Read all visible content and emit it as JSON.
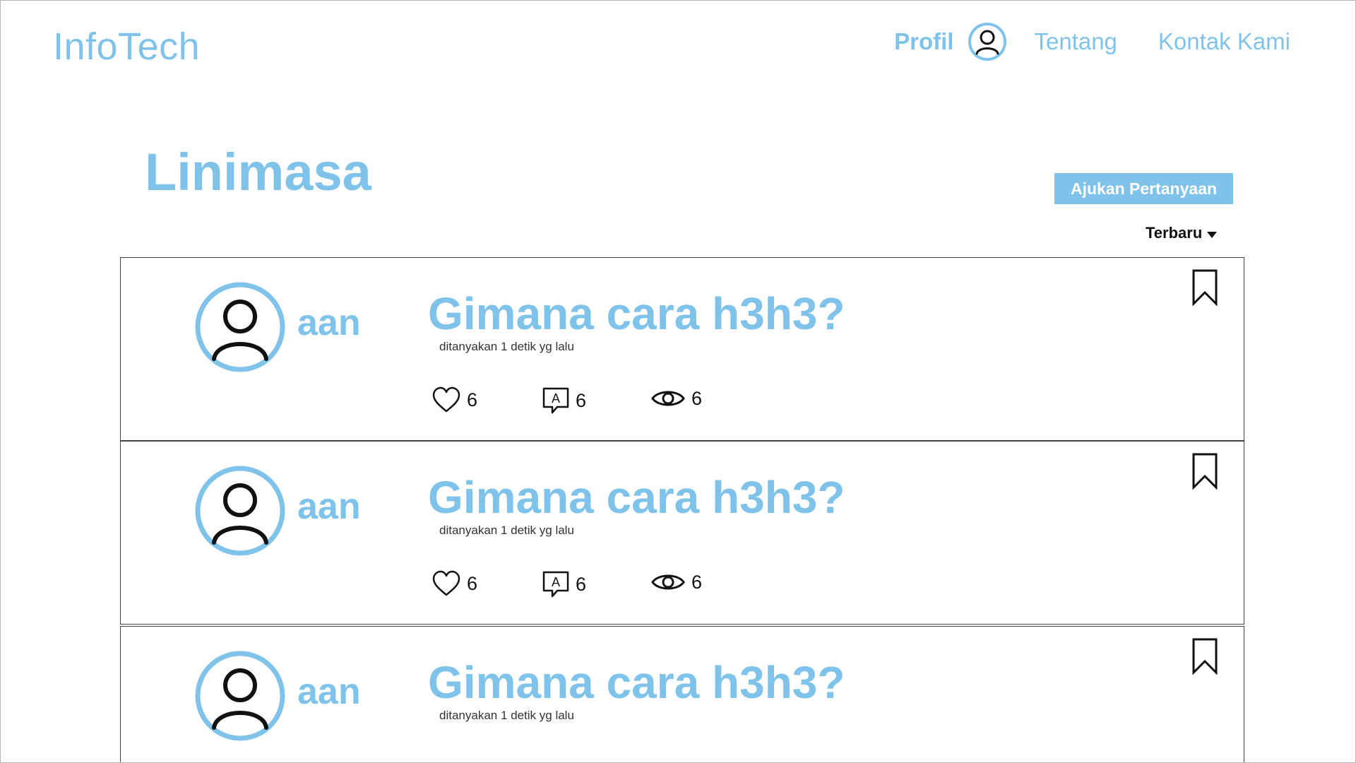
{
  "header": {
    "brand": "InfoTech",
    "nav": {
      "profile": "Profil",
      "about": "Tentang",
      "contact": "Kontak Kami"
    }
  },
  "main": {
    "title": "Linimasa",
    "ask_button": "Ajukan Pertanyaan",
    "sort_label": "Terbaru"
  },
  "posts": [
    {
      "author": "aan",
      "title": "Gimana cara h3h3?",
      "time": "ditanyakan 1 detik yg lalu",
      "likes": "6",
      "answers": "6",
      "views": "6"
    },
    {
      "author": "aan",
      "title": "Gimana cara h3h3?",
      "time": "ditanyakan 1 detik yg lalu",
      "likes": "6",
      "answers": "6",
      "views": "6"
    },
    {
      "author": "aan",
      "title": "Gimana cara h3h3?",
      "time": "ditanyakan 1 detik yg lalu"
    }
  ],
  "colors": {
    "accent": "#80c3ea",
    "text": "#111111",
    "border": "#444444"
  },
  "icons": {
    "avatar": "user-avatar-icon",
    "bookmark": "bookmark-icon",
    "like": "heart-icon",
    "answer": "answer-bubble-icon",
    "view": "eye-icon",
    "sort": "caret-down-icon"
  }
}
